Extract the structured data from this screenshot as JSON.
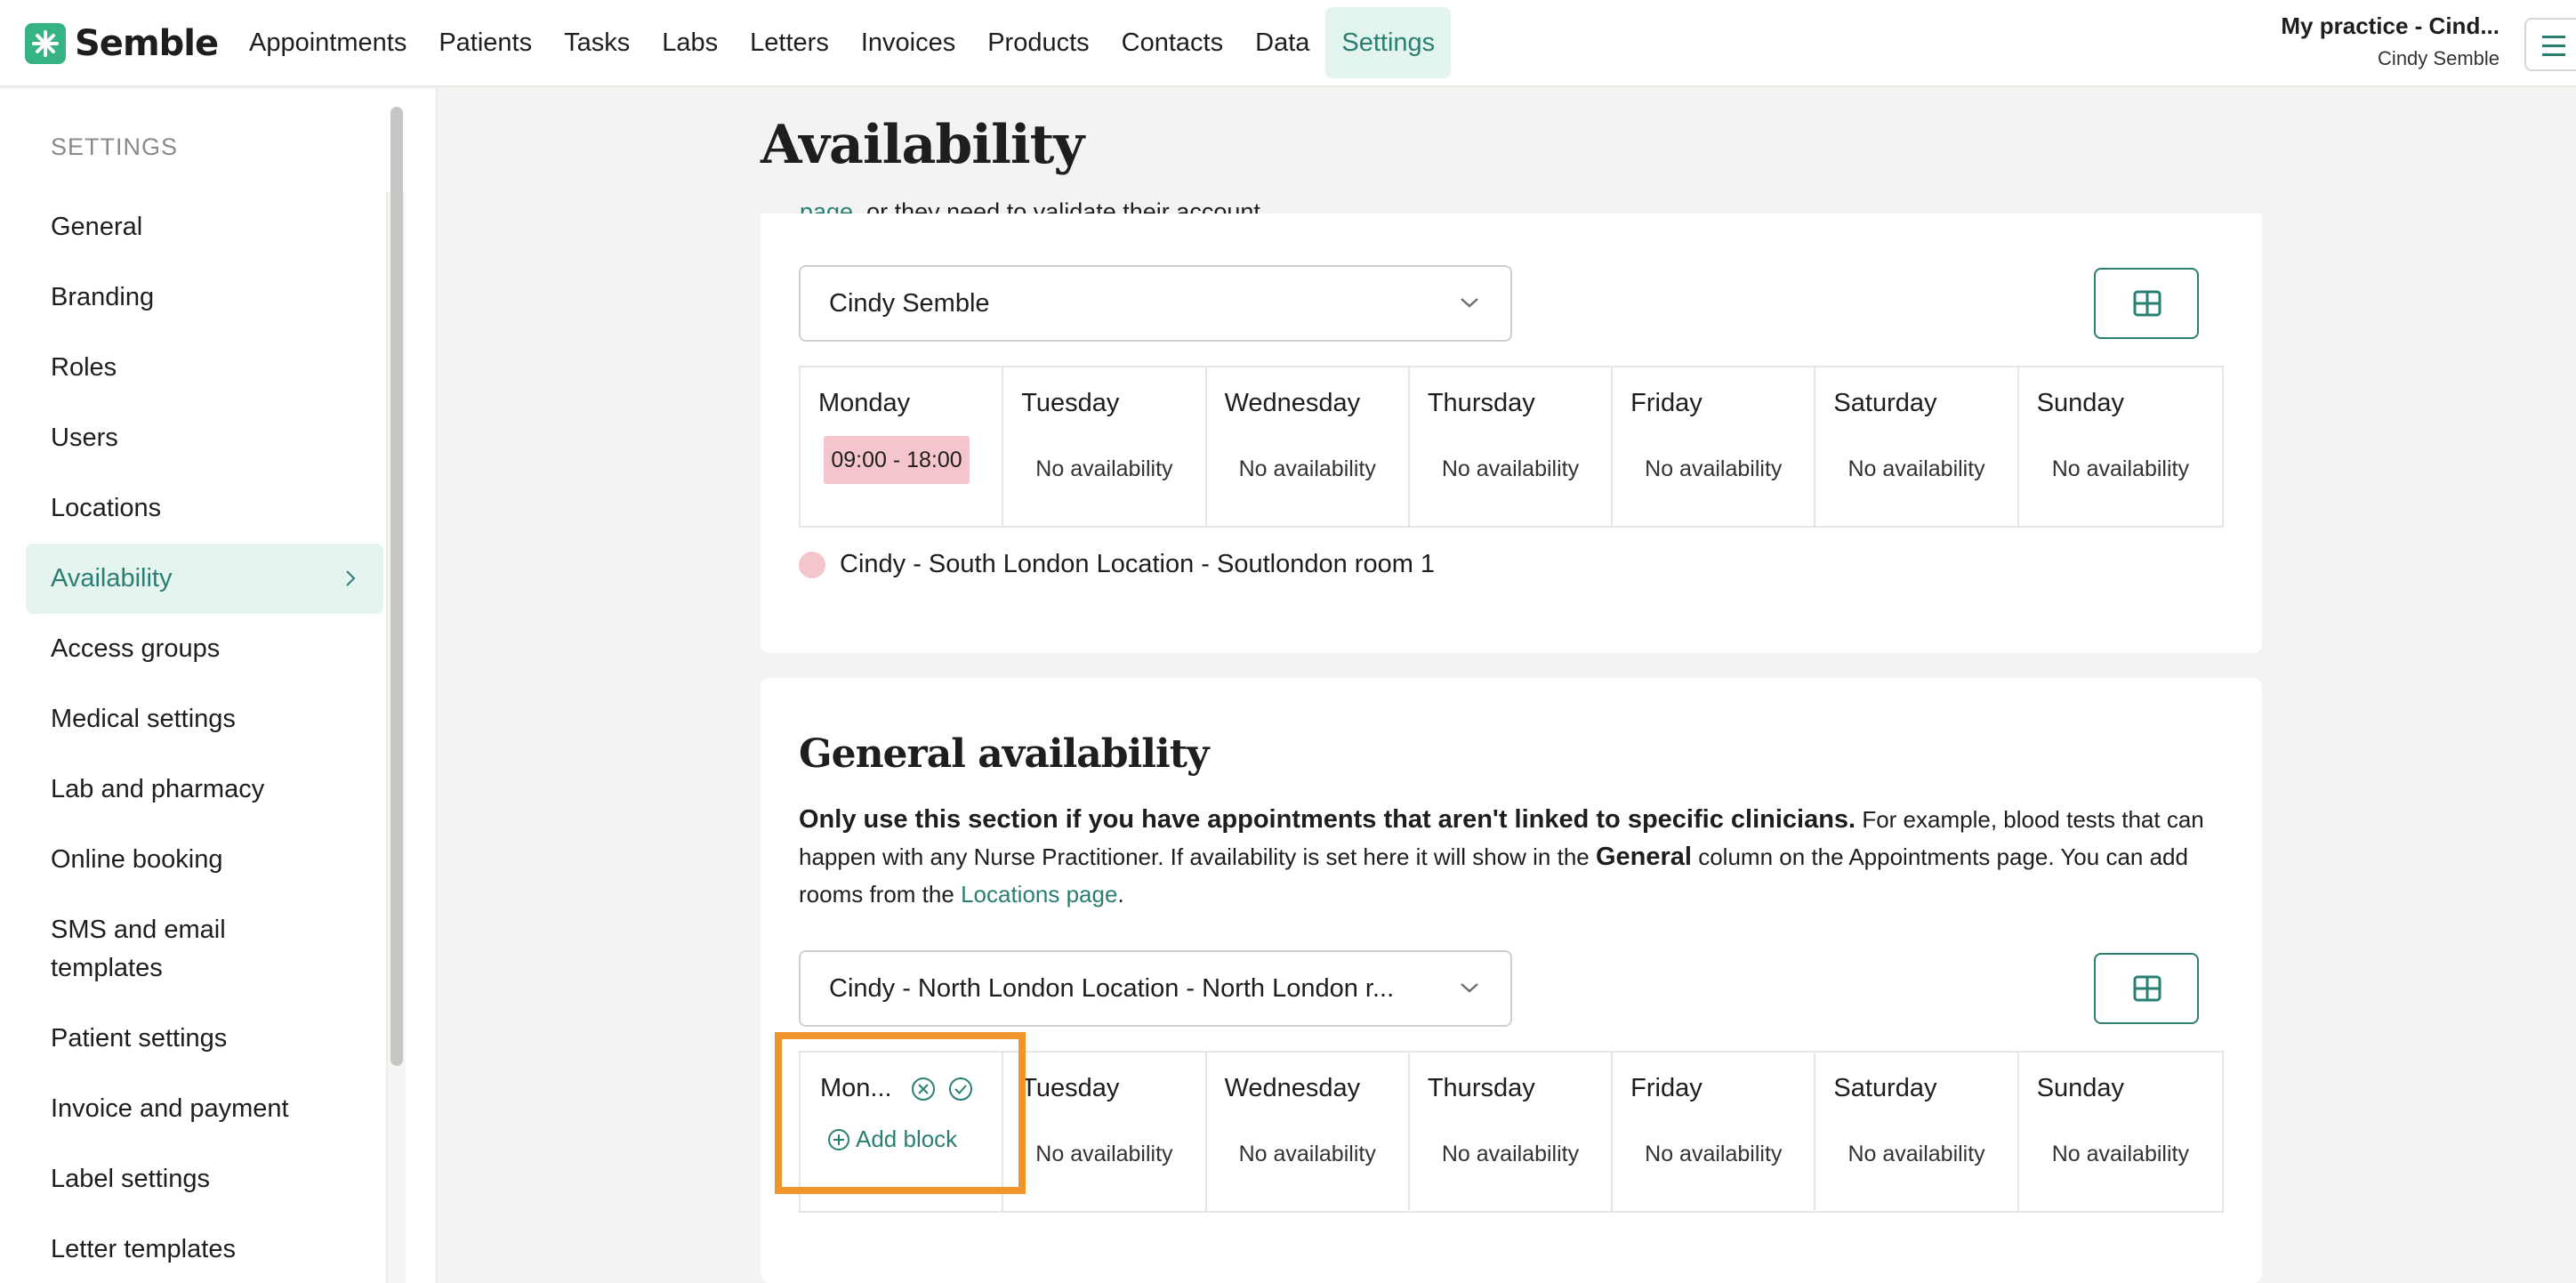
{
  "brand": {
    "name": "Semble",
    "accent": "#2a7f73",
    "logo_color": "#36b384"
  },
  "nav": {
    "items": [
      "Appointments",
      "Patients",
      "Tasks",
      "Labs",
      "Letters",
      "Invoices",
      "Products",
      "Contacts",
      "Data",
      "Settings"
    ],
    "active": "Settings"
  },
  "account": {
    "practice": "My practice - Cind...",
    "user": "Cindy Semble",
    "menu_icon": "hamburger-icon"
  },
  "sidebar": {
    "heading": "SETTINGS",
    "items": [
      "General",
      "Branding",
      "Roles",
      "Users",
      "Locations",
      "Availability",
      "Access groups",
      "Medical settings",
      "Lab and pharmacy",
      "Online booking",
      "SMS and email templates",
      "Patient settings",
      "Invoice and payment",
      "Label settings",
      "Letter templates"
    ],
    "active": "Availability"
  },
  "page": {
    "title": "Availability"
  },
  "clinician_section": {
    "intro_link": "page",
    "intro_tail": ", or they need to validate their account.",
    "select_value": "Cindy Semble",
    "days": [
      "Monday",
      "Tuesday",
      "Wednesday",
      "Thursday",
      "Friday",
      "Saturday",
      "Sunday"
    ],
    "monday_block": "09:00 - 18:00",
    "no_availability": "No availability",
    "legend": "Cindy - South London Location - Soutlondon room 1",
    "block_color": "#f4c6cc"
  },
  "general_section": {
    "title": "General availability",
    "desc_bold": "Only use this section if you have appointments that aren't linked to specific clinicians.",
    "desc_1": " For example, blood tests that can happen with any Nurse Practitioner. If availability is set here it will show in the ",
    "desc_bold_2": "General",
    "desc_2": " column on the Appointments page. You can add rooms from the ",
    "desc_link": "Locations page",
    "desc_end": ".",
    "select_value": "Cindy - North London Location - North London r...",
    "days": [
      "Mon...",
      "Tuesday",
      "Wednesday",
      "Thursday",
      "Friday",
      "Saturday",
      "Sunday"
    ],
    "no_availability": "No availability",
    "add_block": "Add block",
    "highlight_color": "#f0942b"
  }
}
